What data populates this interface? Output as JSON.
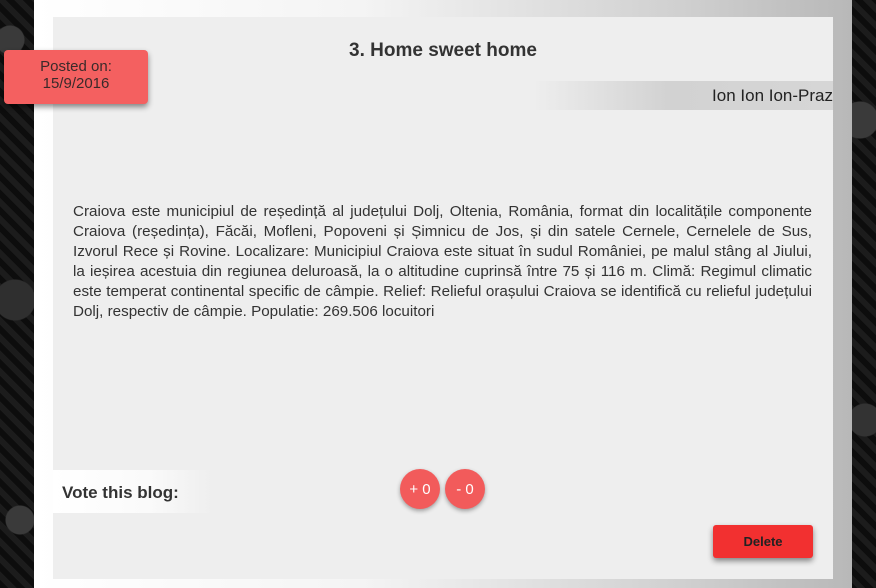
{
  "post": {
    "title": "3. Home sweet home",
    "author": "Ion Ion Ion-Praz",
    "posted_label": "Posted on:",
    "posted_date": "15/9/2016",
    "body": "Craiova este municipiul de reședință al județului Dolj, Oltenia, România, format din localitățile componente Craiova (reședința), Făcăi, Mofleni, Popoveni și Șimnicu de Jos, și din satele Cernele, Cernelele de Sus, Izvorul Rece și Rovine. Localizare: Municipiul Craiova este situat în sudul României, pe malul stâng al Jiului, la ieșirea acestuia din regiunea deluroasă, la o altitudine cuprinsă între 75 și 116 m. Climă: Regimul climatic este temperat continental specific de câmpie. Relief: Relieful orașului Craiova se identifică cu relieful județului Dolj, respectiv de câmpie. Populatie: 269.506 locuitori"
  },
  "vote": {
    "label": "Vote this blog:",
    "up_label": "+ 0",
    "down_label": "- 0"
  },
  "actions": {
    "delete_label": "Delete"
  },
  "colors": {
    "accent": "#f46060",
    "delete": "#f23030",
    "card": "#eeeeee"
  }
}
